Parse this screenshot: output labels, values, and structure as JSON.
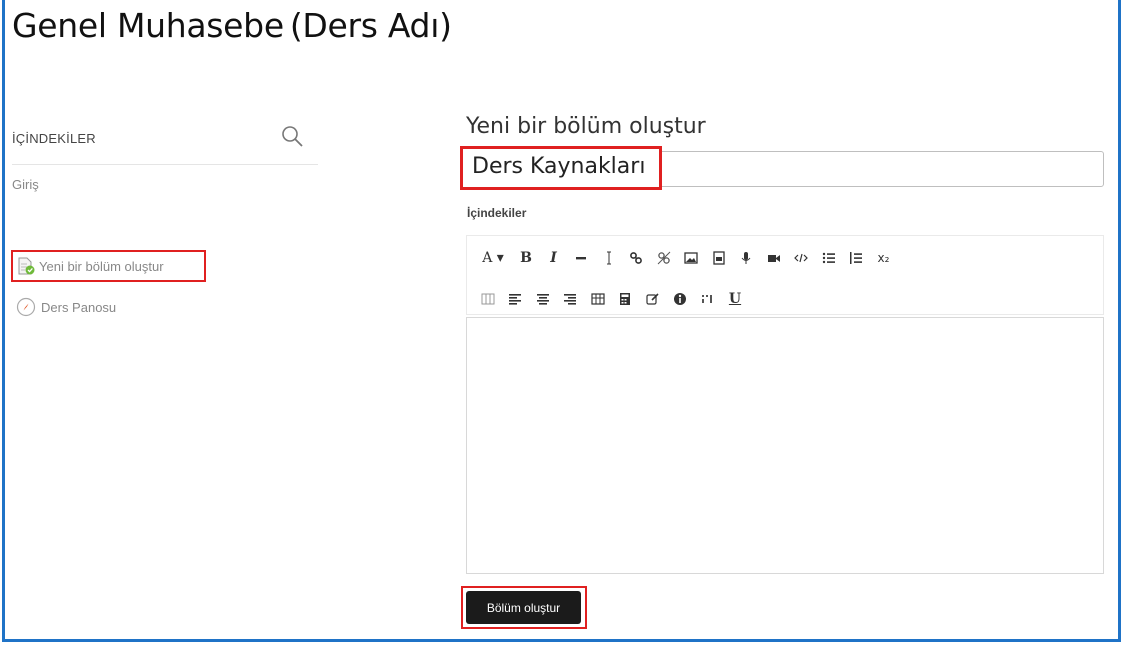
{
  "page": {
    "title": "Genel Muhasebe",
    "course_note": "(Ders Adı)"
  },
  "sidebar": {
    "toc_label": "İÇİNDEKİLER",
    "items": [
      {
        "label": "Giriş"
      },
      {
        "label": "Yeni bir bölüm oluştur",
        "icon": "page-add-icon"
      },
      {
        "label": "Ders Panosu",
        "icon": "compass-icon"
      }
    ]
  },
  "form": {
    "title": "Yeni bir bölüm oluştur",
    "name_value": "Ders Kaynakları",
    "content_label": "İçindekiler",
    "submit_label": "Bölüm oluştur"
  },
  "toolbar": {
    "row1": [
      "font-size",
      "bold",
      "italic",
      "horizontal-rule",
      "cursor",
      "link",
      "unlink",
      "image",
      "media",
      "microphone",
      "video",
      "html",
      "bullet-list",
      "numbered-list",
      "subscript"
    ],
    "row2": [
      "column",
      "align-left",
      "align-center",
      "align-right",
      "table",
      "calculator",
      "edit",
      "accessibility",
      "special-char",
      "underline"
    ],
    "labels": {
      "font_size": "A ▾",
      "bold": "B",
      "italic": "I",
      "underline": "U",
      "subscript": "x₂"
    }
  },
  "colors": {
    "frame": "#1f73c7",
    "highlight": "#e02020",
    "button_bg": "#1b1b1b"
  }
}
